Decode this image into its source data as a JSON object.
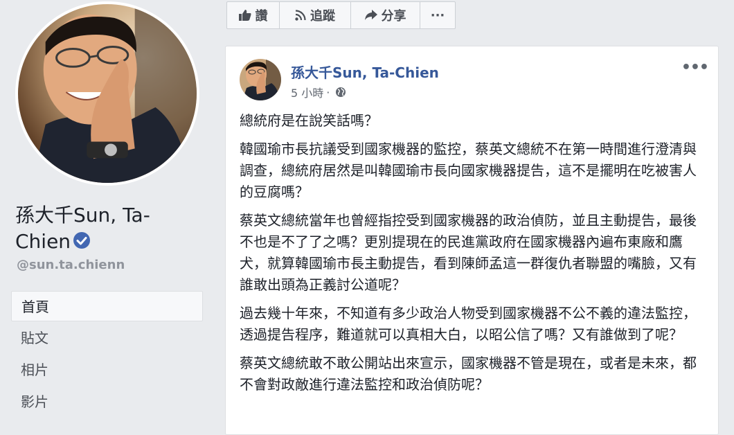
{
  "profile": {
    "name": "孫大千Sun, Ta-Chien",
    "name_line1": "孫大千Sun, Ta-",
    "name_line2": "Chien",
    "handle": "@sun.ta.chienn",
    "verified_icon": "verified-check-icon"
  },
  "nav": {
    "items": [
      {
        "label": "首頁",
        "active": true
      },
      {
        "label": "貼文",
        "active": false
      },
      {
        "label": "相片",
        "active": false
      },
      {
        "label": "影片",
        "active": false
      }
    ]
  },
  "actions": {
    "like": {
      "label": "讚",
      "icon": "thumbs-up-icon"
    },
    "follow": {
      "label": "追蹤",
      "icon": "rss-icon"
    },
    "share": {
      "label": "分享",
      "icon": "share-arrow-icon"
    },
    "more": {
      "label": "···",
      "icon": "more-dots-icon"
    }
  },
  "post": {
    "author": "孫大千Sun, Ta-Chien",
    "time": "5 小時",
    "separator": "·",
    "privacy_icon": "globe-icon",
    "more": "•••",
    "paragraphs": [
      "總統府是在說笑話嗎？",
      "韓國瑜市長抗議受到國家機器的監控，蔡英文總統不在第一時間進行澄清與調查，總統府居然是叫韓國瑜市長向國家機器提告，這不是擺明在吃被害人的豆腐嗎？",
      "蔡英文總統當年也曾經指控受到國家機器的政治偵防，並且主動提告，最後不也是不了了之嗎？更別提現在的民進黨政府在國家機器內遍布東廠和鷹犬，就算韓國瑜市長主動提告，看到陳師孟這一群復仇者聯盟的嘴臉，又有誰敢出頭為正義討公道呢？",
      "過去幾十年來，不知道有多少政治人物受到國家機器不公不義的違法監控，透過提告程序，難道就可以真相大白，以昭公信了嗎？又有誰做到了呢？",
      "蔡英文總統敢不敢公開站出來宣示，國家機器不管是現在，或者是未來，都不會對政敵進行違法監控和政治偵防呢？"
    ]
  },
  "colors": {
    "background": "#e9ebee",
    "link_blue": "#365899",
    "verified_blue": "#4267b2"
  }
}
